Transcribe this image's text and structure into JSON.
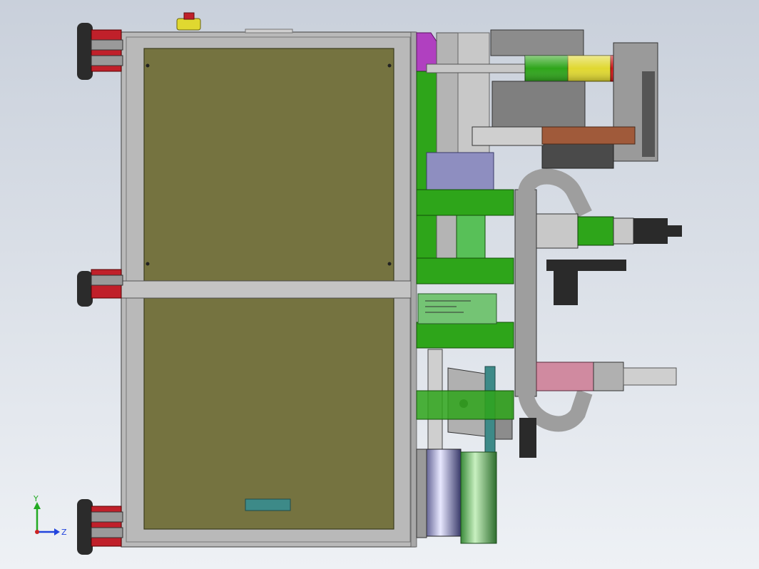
{
  "viewport": {
    "background_top": "#c9d0db",
    "background_bottom": "#eef1f5"
  },
  "triad": {
    "y_label": "Y",
    "z_label": "Z",
    "y_color": "#22aa22",
    "z_color": "#2244dd",
    "origin_color": "#cc2222"
  },
  "colors": {
    "frame": "#b9b9b9",
    "frame_edge": "#555555",
    "panel": "#757340",
    "panel_edge": "#3c3c20",
    "foot": "#2b2b2b",
    "foot_red": "#c0202a",
    "magenta": "#b040c0",
    "green": "#2ea51a",
    "light_green": "#58c058",
    "pale_green": "#74c474",
    "yellow": "#e0d830",
    "red": "#d81818",
    "teal": "#3d8a88",
    "dark": "#2a2a2a",
    "gray": "#8c8c8c",
    "blue_gray": "#8e8ec0",
    "brown": "#a05a3a",
    "pink": "#d08aa0"
  }
}
